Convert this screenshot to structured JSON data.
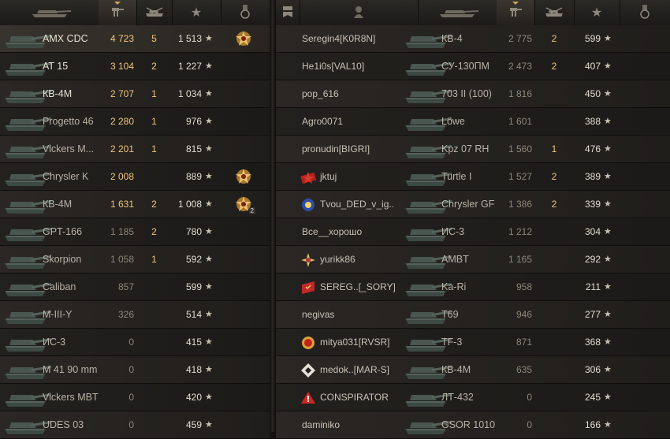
{
  "header": {
    "sort_caret": "caret-down-icon",
    "left_columns": [
      "tank-silhouette-icon",
      "damage-icon",
      "kills-icon",
      "xp-star-icon",
      "medal-icon"
    ],
    "right_columns": [
      "platoon-icon",
      "player-icon",
      "tank-silhouette-icon",
      "damage-icon",
      "kills-icon",
      "xp-star-icon",
      "medal-icon"
    ]
  },
  "colors": {
    "gold": "#f1c47a",
    "text": "#e6e1d4",
    "dim": "#8e877a",
    "background": "#1a1816"
  },
  "left_team": [
    {
      "vehicle": "AMX CDC",
      "damage": "4 723",
      "kills": "5",
      "xp": "1 513",
      "medal": "gold-medal-icon",
      "medal_count": "",
      "self": true
    },
    {
      "vehicle": "AT 15",
      "damage": "3 104",
      "kills": "2",
      "xp": "1 227",
      "medal": "",
      "medal_count": ""
    },
    {
      "vehicle": "КВ-4М",
      "damage": "2 707",
      "kills": "1",
      "xp": "1 034",
      "medal": "",
      "medal_count": ""
    },
    {
      "vehicle": "Progetto 46",
      "damage": "2 280",
      "kills": "1",
      "xp": "976",
      "medal": "",
      "medal_count": ""
    },
    {
      "vehicle": "Vickers M...",
      "damage": "2 201",
      "kills": "1",
      "xp": "815",
      "medal": "",
      "medal_count": ""
    },
    {
      "vehicle": "Chrysler K",
      "damage": "2 008",
      "kills": "",
      "xp": "889",
      "medal": "gold-medal-icon",
      "medal_count": ""
    },
    {
      "vehicle": "КВ-4М",
      "damage": "1 631",
      "kills": "2",
      "xp": "1 008",
      "medal": "gold-medal-icon",
      "medal_count": "2"
    },
    {
      "vehicle": "GPT-166",
      "damage": "1 185",
      "kills": "2",
      "xp": "780",
      "medal": "",
      "medal_count": ""
    },
    {
      "vehicle": "Skorpion",
      "damage": "1 058",
      "kills": "1",
      "xp": "592",
      "medal": "",
      "medal_count": ""
    },
    {
      "vehicle": "Caliban",
      "damage": "857",
      "kills": "",
      "xp": "599",
      "medal": "",
      "medal_count": ""
    },
    {
      "vehicle": "M-III-Y",
      "damage": "326",
      "kills": "",
      "xp": "514",
      "medal": "",
      "medal_count": ""
    },
    {
      "vehicle": "ИС-3",
      "damage": "0",
      "kills": "",
      "xp": "415",
      "medal": "",
      "medal_count": ""
    },
    {
      "vehicle": "M 41 90 mm",
      "damage": "0",
      "kills": "",
      "xp": "418",
      "medal": "",
      "medal_count": ""
    },
    {
      "vehicle": "Vickers MBT",
      "damage": "0",
      "kills": "",
      "xp": "420",
      "medal": "",
      "medal_count": ""
    },
    {
      "vehicle": "UDES 03",
      "damage": "0",
      "kills": "",
      "xp": "459",
      "medal": "",
      "medal_count": ""
    }
  ],
  "right_team": [
    {
      "player": "Seregin4[K0R8N]",
      "vehicle": "КВ-4",
      "damage": "2 775",
      "kills": "2",
      "xp": "599",
      "clan_icon": ""
    },
    {
      "player": "He1i0s[VAL10]",
      "vehicle": "СУ-130ПМ",
      "damage": "2 473",
      "kills": "2",
      "xp": "407",
      "clan_icon": ""
    },
    {
      "player": "pop_616",
      "vehicle": "703 II (100)",
      "damage": "1 816",
      "kills": "",
      "xp": "450",
      "clan_icon": ""
    },
    {
      "player": "Agro0071",
      "vehicle": "Löwe",
      "damage": "1 601",
      "kills": "",
      "xp": "388",
      "clan_icon": ""
    },
    {
      "player": "pronudin[BIGRI]",
      "vehicle": "Kpz 07 RH",
      "damage": "1 560",
      "kills": "1",
      "xp": "476",
      "clan_icon": ""
    },
    {
      "player": "jktuj",
      "vehicle": "Turtle I",
      "damage": "1 527",
      "kills": "2",
      "xp": "389",
      "clan_icon": "red-star-emblem-icon"
    },
    {
      "player": "Tvou_DED_v_ig..",
      "vehicle": "Chrysler GF",
      "damage": "1 386",
      "kills": "2",
      "xp": "339",
      "clan_icon": "blue-flower-emblem-icon"
    },
    {
      "player": "Все__хорошо",
      "vehicle": "ИС-3",
      "damage": "1 212",
      "kills": "",
      "xp": "304",
      "clan_icon": ""
    },
    {
      "player": "yurikk86",
      "vehicle": "AMBT",
      "damage": "1 165",
      "kills": "",
      "xp": "292",
      "clan_icon": "gold-burst-emblem-icon"
    },
    {
      "player": "SEREG..[_SORY]",
      "vehicle": "Ka-Ri",
      "damage": "958",
      "kills": "",
      "xp": "211",
      "clan_icon": "red-flag-emblem-icon"
    },
    {
      "player": "negivas",
      "vehicle": "T69",
      "damage": "946",
      "kills": "",
      "xp": "277",
      "clan_icon": ""
    },
    {
      "player": "mitya031[RVSR]",
      "vehicle": "TF-3",
      "damage": "871",
      "kills": "",
      "xp": "368",
      "clan_icon": "red-shield-emblem-icon"
    },
    {
      "player": "medok..[MAR-S]",
      "vehicle": "КВ-4М",
      "damage": "635",
      "kills": "",
      "xp": "306",
      "clan_icon": "diamond-emblem-icon"
    },
    {
      "player": "CONSPIRATOR",
      "vehicle": "ЛТ-432",
      "damage": "0",
      "kills": "",
      "xp": "245",
      "clan_icon": "red-triangle-emblem-icon"
    },
    {
      "player": "daminiko",
      "vehicle": "GSOR 1010",
      "damage": "0",
      "kills": "",
      "xp": "166",
      "clan_icon": ""
    }
  ]
}
